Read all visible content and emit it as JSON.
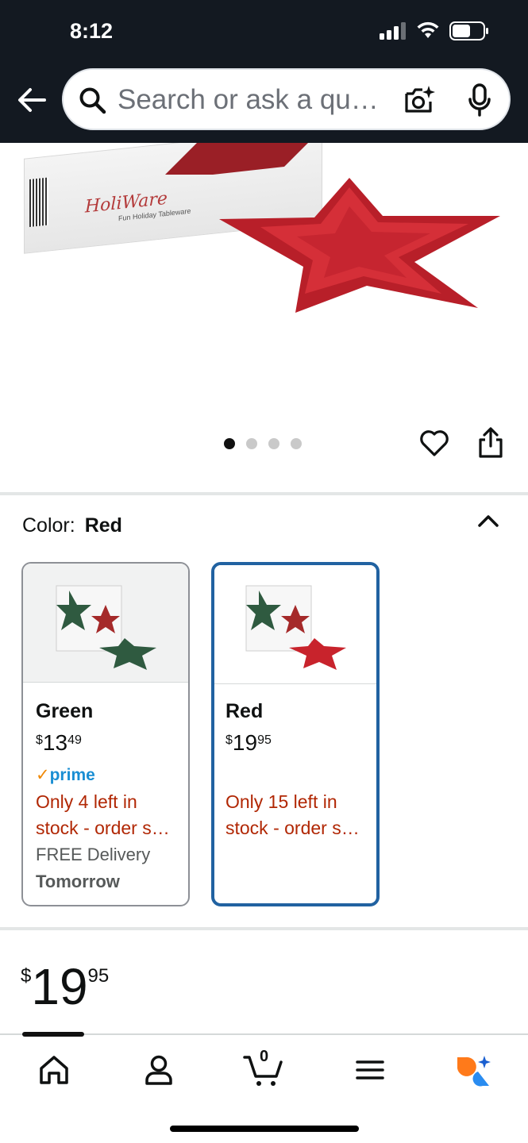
{
  "status_bar": {
    "time": "8:12"
  },
  "search": {
    "placeholder": "Search or ask a question"
  },
  "product_image": {
    "brand_text": "HoliWare",
    "brand_subtext": "Fun Holiday Tableware",
    "carousel_total": 4,
    "carousel_active_index": 0
  },
  "color_selector": {
    "label": "Color:",
    "selected_value": "Red",
    "options": [
      {
        "name": "Green",
        "price_currency": "$",
        "price_whole": "13",
        "price_fraction": "49",
        "prime_label": "prime",
        "stock_line1": "Only 4 left in",
        "stock_line2": "stock - order soon.",
        "delivery_label": "FREE Delivery",
        "delivery_day": "Tomorrow",
        "selected": false
      },
      {
        "name": "Red",
        "price_currency": "$",
        "price_whole": "19",
        "price_fraction": "95",
        "stock_line1": "Only 15 left in",
        "stock_line2": "stock - order soon.",
        "selected": true
      }
    ]
  },
  "price": {
    "currency": "$",
    "whole": "19",
    "fraction": "95"
  },
  "bottom_nav": {
    "cart_count": "0",
    "items": [
      "home-icon",
      "account-icon",
      "cart-icon",
      "menu-icon",
      "rufus-icon"
    ]
  },
  "colors": {
    "header_bg": "#131921",
    "selected_border": "#2162a1",
    "stock_red": "#b12704",
    "prime_blue": "#1a8ed3",
    "star_red": "#c8232c",
    "star_green": "#2f5a40"
  }
}
